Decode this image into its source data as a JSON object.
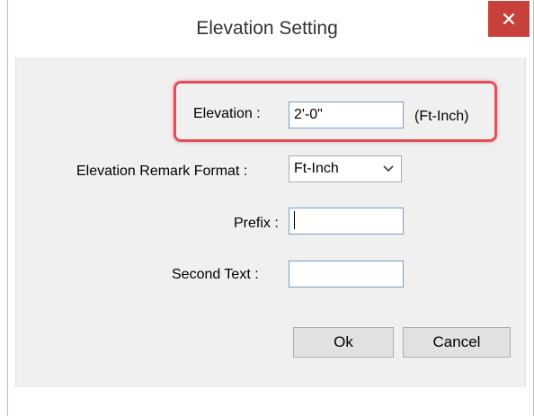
{
  "window": {
    "title": "Elevation Setting",
    "close_icon": "close-icon"
  },
  "form": {
    "elevation": {
      "label": "Elevation :",
      "value": "2'-0\"",
      "unit": "(Ft-Inch)"
    },
    "remark_format": {
      "label": "Elevation Remark Format :",
      "selected": "Ft-Inch"
    },
    "prefix": {
      "label": "Prefix :",
      "value": ""
    },
    "second_text": {
      "label": "Second Text :",
      "value": ""
    }
  },
  "buttons": {
    "ok": "Ok",
    "cancel": "Cancel"
  },
  "colors": {
    "close_button": "#c7403a",
    "highlight": "#e0505a",
    "client_background": "#f0f0f0"
  }
}
